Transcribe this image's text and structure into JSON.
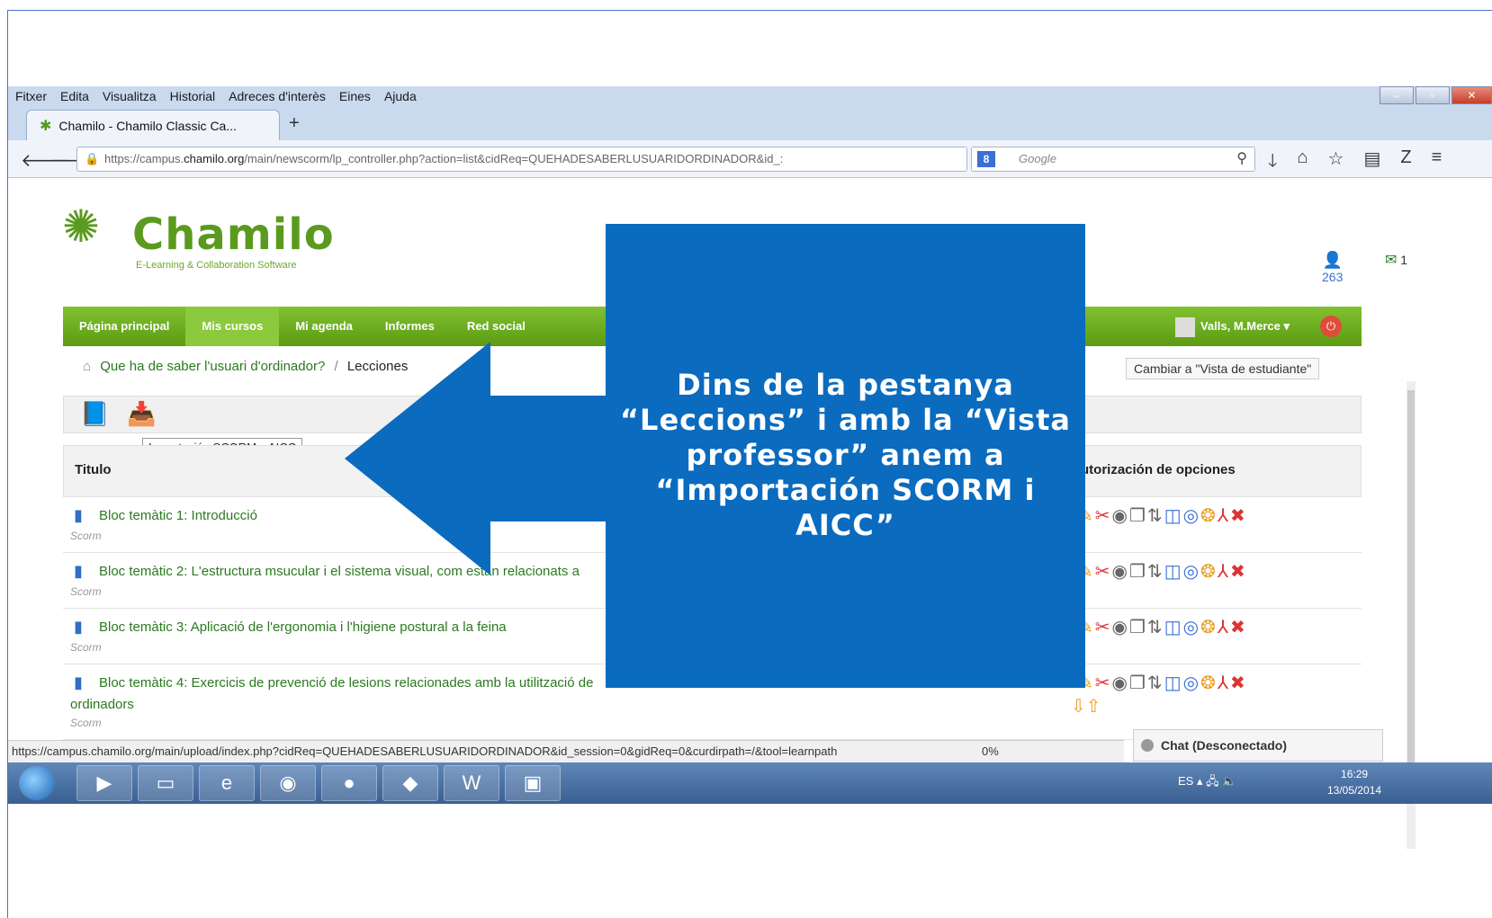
{
  "menu": [
    "Fitxer",
    "Edita",
    "Visualitza",
    "Historial",
    "Adreces d'interès",
    "Eines",
    "Ajuda"
  ],
  "tab": {
    "title": "Chamilo - Chamilo Classic Ca..."
  },
  "url": {
    "prefix": "https://campus.",
    "domain": "chamilo.org",
    "path": "/main/newscorm/lp_controller.php?action=list&cidReq=QUEHADESABERLUSUARIDORDINADOR&id_:"
  },
  "search": {
    "placeholder": "Google"
  },
  "logo": {
    "name": "Chamilo",
    "tagline": "E-Learning & Collaboration Software"
  },
  "header": {
    "user_count": "263",
    "msg_count": "1"
  },
  "nav": {
    "items": [
      "Página principal",
      "Mis cursos",
      "Mi agenda",
      "Informes",
      "Red social"
    ],
    "active": "Mis cursos",
    "user": "Valls, M.Merce"
  },
  "breadcrumb": {
    "course": "Que ha de saber l'usuari d'ordinador?",
    "current": "Lecciones"
  },
  "switch_view": "Cambiar a \"Vista de estudiante\"",
  "tooltip": "Importación SCORM y AICC",
  "table": {
    "col_title": "Titulo",
    "col_options": "utorización de opciones",
    "rows": [
      {
        "title": "Bloc temàtic 1: Introducció",
        "type": "Scorm"
      },
      {
        "title": "Bloc temàtic 2: L'estructura msucular i el sistema visual, com estan relacionats a",
        "type": "Scorm"
      },
      {
        "title": "Bloc temàtic 3: Aplicació de l'ergonomia i l'higiene postural a la feina",
        "type": "Scorm"
      },
      {
        "title": "Bloc temàtic 4: Exercicis de prevenció de lesions relacionades amb la utilització de",
        "title_cont": "ordinadors",
        "type": "Scorm"
      }
    ]
  },
  "statusbar": {
    "url": "https://campus.chamilo.org/main/upload/index.php?cidReq=QUEHADESABERLUSUARIDORDINADOR&id_session=0&gidReq=0&curdirpath=/&tool=learnpath",
    "progress": "0%"
  },
  "chat": "Chat (Desconectado)",
  "taskbar": {
    "lang": "ES",
    "time": "16:29",
    "date": "13/05/2014"
  },
  "callout": {
    "text": "Dins de la pestanya “Leccions” i amb la “Vista professor” anem a “Importación SCORM i AICC”"
  },
  "colors": {
    "callout": "#0a6bbf",
    "brand_green": "#5a9a1e"
  }
}
